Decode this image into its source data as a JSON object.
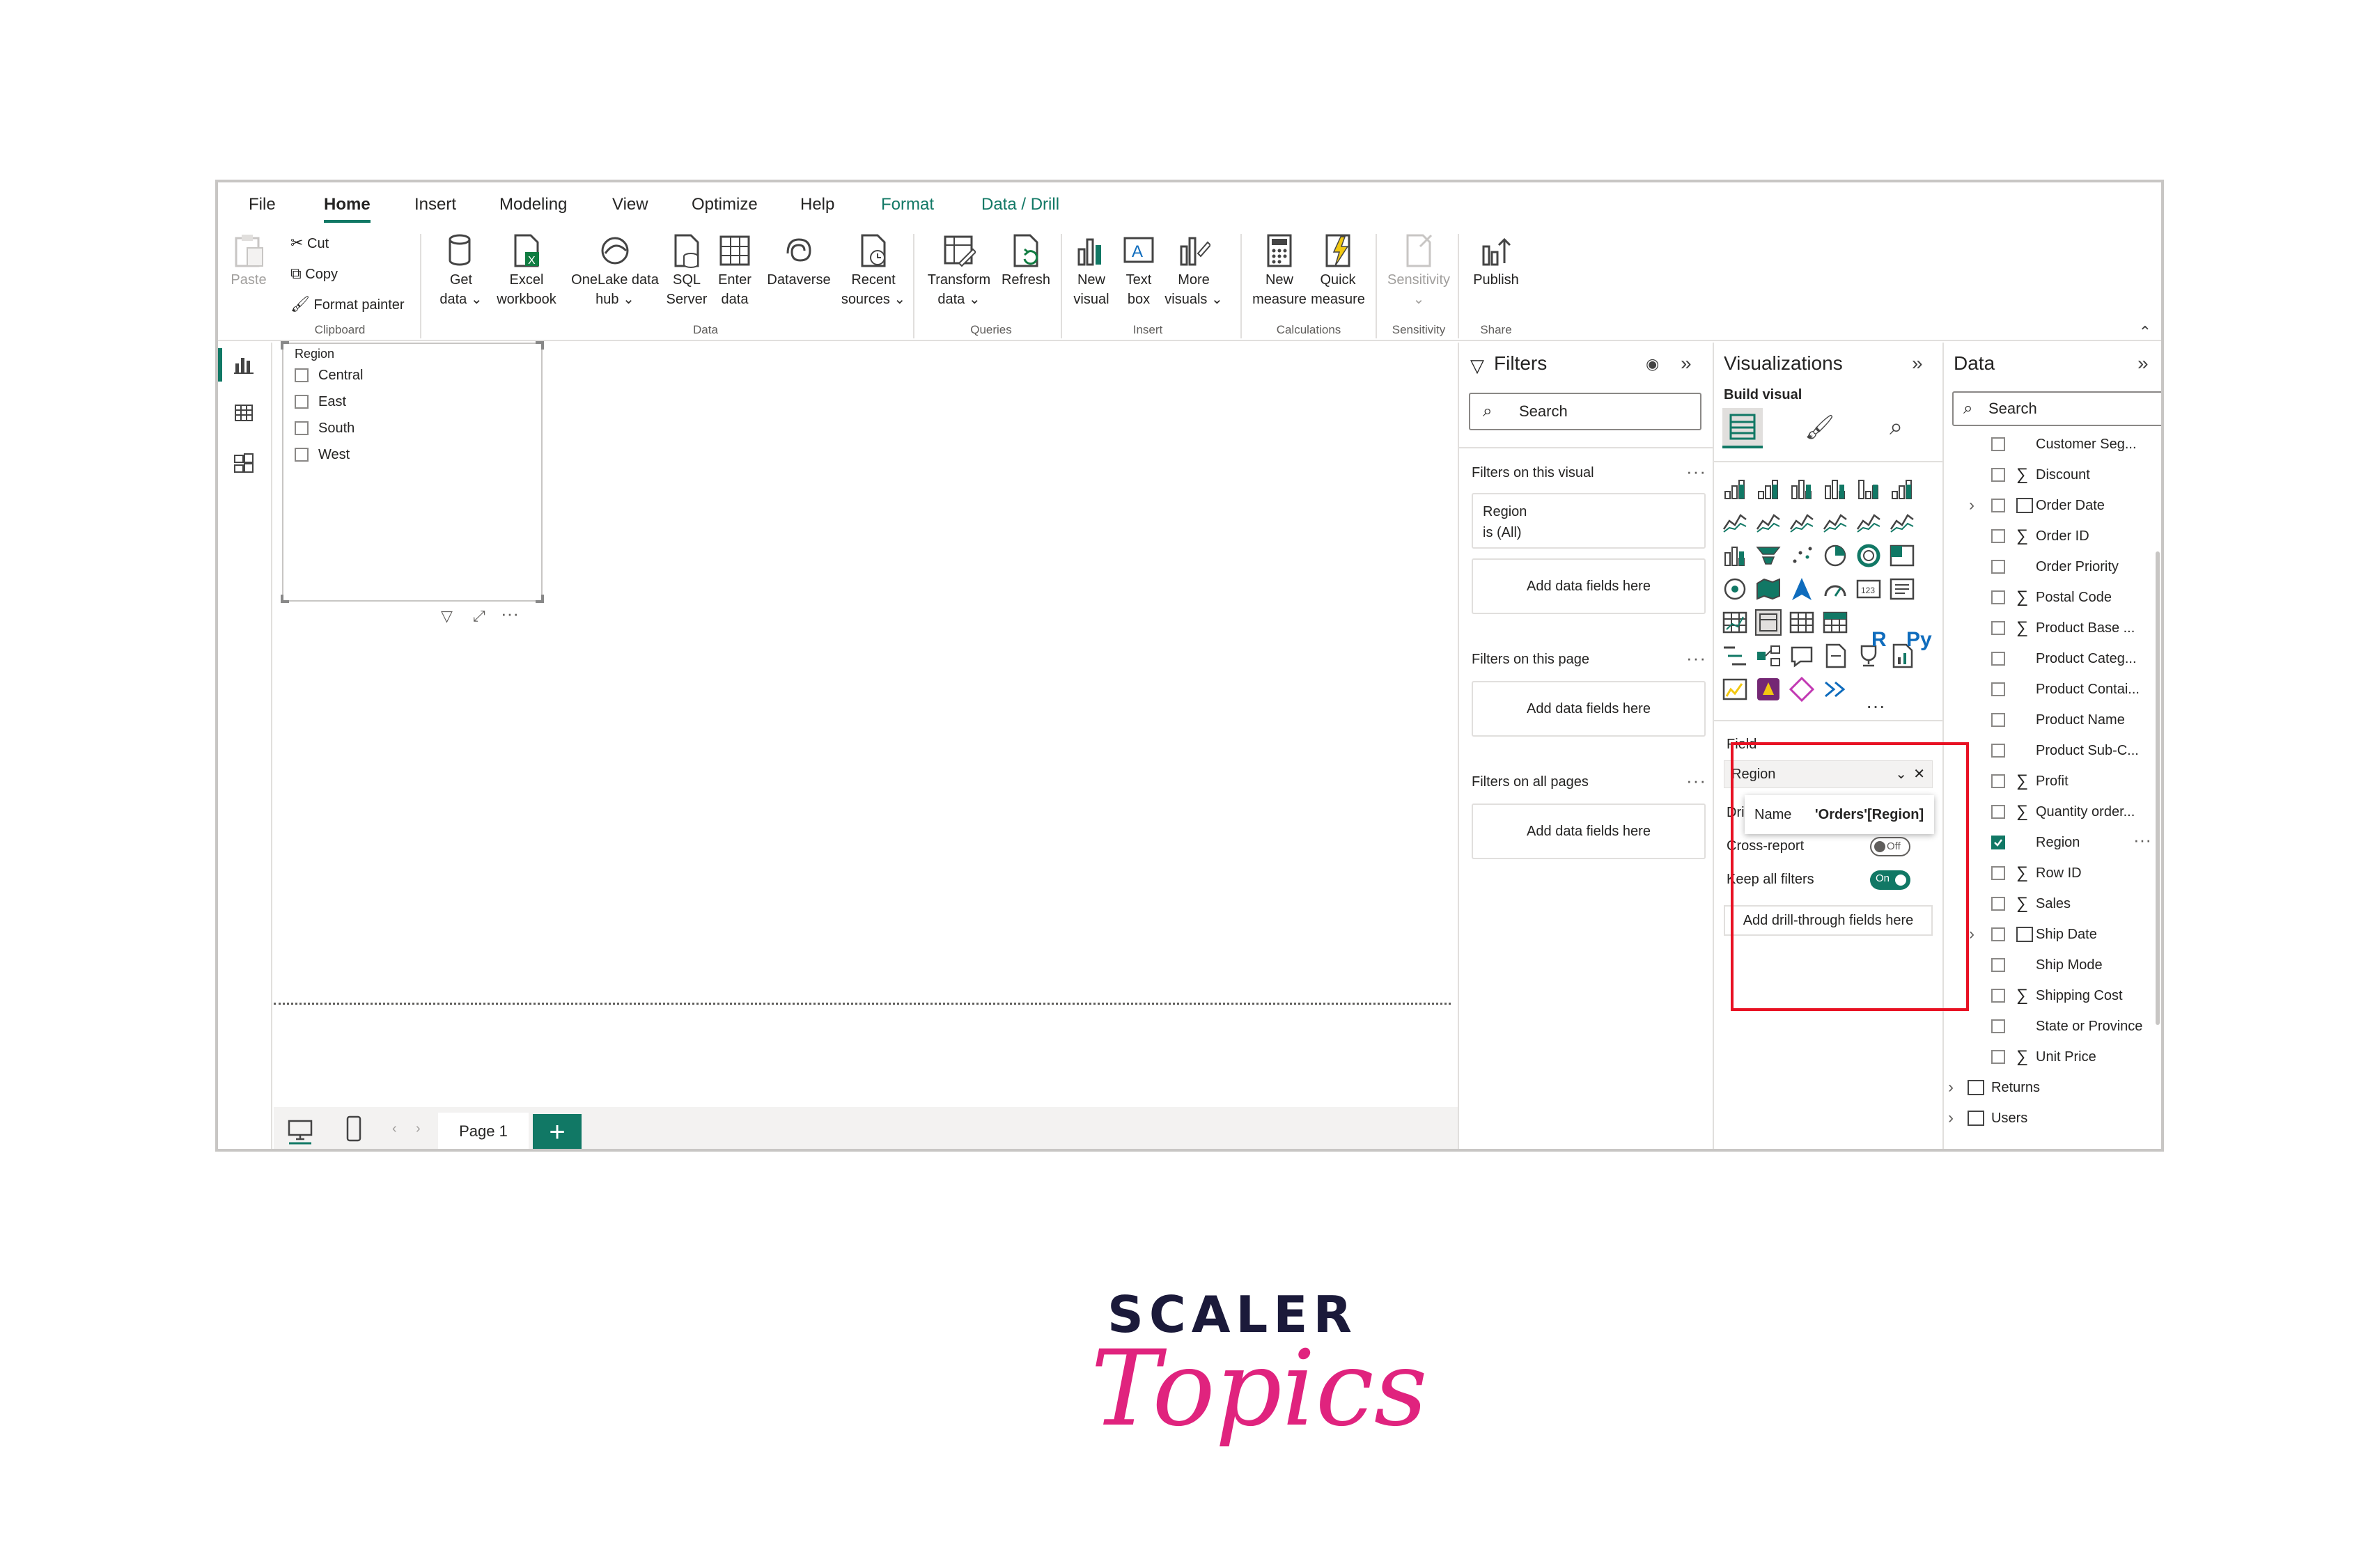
{
  "tabs": [
    "File",
    "Home",
    "Insert",
    "Modeling",
    "View",
    "Optimize",
    "Help",
    "Format",
    "Data / Drill"
  ],
  "ribbon": {
    "paste": "Paste",
    "cut": "Cut",
    "copy": "Copy",
    "format_painter": "Format painter",
    "group_clipboard": "Clipboard",
    "get_data": [
      "Get",
      "data"
    ],
    "excel_workbook": [
      "Excel",
      "workbook"
    ],
    "onelake": [
      "OneLake data",
      "hub"
    ],
    "sql_server": [
      "SQL",
      "Server"
    ],
    "enter_data": [
      "Enter",
      "data"
    ],
    "dataverse": "Dataverse",
    "recent_sources": [
      "Recent",
      "sources"
    ],
    "group_data": "Data",
    "transform_data": [
      "Transform",
      "data"
    ],
    "refresh": "Refresh",
    "group_queries": "Queries",
    "new_visual": [
      "New",
      "visual"
    ],
    "text_box": [
      "Text",
      "box"
    ],
    "more_visuals": [
      "More",
      "visuals"
    ],
    "group_insert": "Insert",
    "new_measure": [
      "New",
      "measure"
    ],
    "quick_measure": [
      "Quick",
      "measure"
    ],
    "group_calculations": "Calculations",
    "sensitivity": "Sensitivity",
    "group_sensitivity": "Sensitivity",
    "publish": "Publish",
    "group_share": "Share"
  },
  "slicer": {
    "title": "Region",
    "items": [
      "Central",
      "East",
      "South",
      "West"
    ]
  },
  "pages": {
    "current": "Page 1",
    "add": "+"
  },
  "filters": {
    "title": "Filters",
    "search_placeholder": "Search",
    "on_visual": "Filters on this visual",
    "region_card": {
      "field": "Region",
      "value": "is (All)"
    },
    "add_fields": "Add data fields here",
    "on_page": "Filters on this page",
    "on_all_pages": "Filters on all pages"
  },
  "visualizations": {
    "title": "Visualizations",
    "build_visual": "Build visual",
    "r_label": "R",
    "py_label": "Py",
    "more": "···",
    "drill": {
      "field_label": "Field",
      "field_value": "Region",
      "tooltip_name": "Name",
      "tooltip_value": "'Orders'[Region]",
      "drill_prefix": "Dri",
      "cross_report": "Cross-report",
      "cross_report_state": "Off",
      "keep_all_filters": "Keep all filters",
      "keep_state": "On",
      "add_drill": "Add drill-through fields here"
    }
  },
  "data_pane": {
    "title": "Data",
    "search_placeholder": "Search",
    "fields": [
      {
        "label": "Customer Seg...",
        "sigma": false,
        "table": false,
        "checked": false
      },
      {
        "label": "Discount",
        "sigma": true,
        "table": false,
        "checked": false
      },
      {
        "label": "Order Date",
        "sigma": false,
        "table": true,
        "checked": false,
        "expand": true
      },
      {
        "label": "Order ID",
        "sigma": true,
        "table": false,
        "checked": false
      },
      {
        "label": "Order Priority",
        "sigma": false,
        "table": false,
        "checked": false
      },
      {
        "label": "Postal Code",
        "sigma": true,
        "table": false,
        "checked": false
      },
      {
        "label": "Product Base ...",
        "sigma": true,
        "table": false,
        "checked": false
      },
      {
        "label": "Product Categ...",
        "sigma": false,
        "table": false,
        "checked": false
      },
      {
        "label": "Product Contai...",
        "sigma": false,
        "table": false,
        "checked": false
      },
      {
        "label": "Product Name",
        "sigma": false,
        "table": false,
        "checked": false
      },
      {
        "label": "Product Sub-C...",
        "sigma": false,
        "table": false,
        "checked": false
      },
      {
        "label": "Profit",
        "sigma": true,
        "table": false,
        "checked": false
      },
      {
        "label": "Quantity order...",
        "sigma": true,
        "table": false,
        "checked": false
      },
      {
        "label": "Region",
        "sigma": false,
        "table": false,
        "checked": true
      },
      {
        "label": "Row ID",
        "sigma": true,
        "table": false,
        "checked": false
      },
      {
        "label": "Sales",
        "sigma": true,
        "table": false,
        "checked": false
      },
      {
        "label": "Ship Date",
        "sigma": false,
        "table": true,
        "checked": false,
        "expand": true
      },
      {
        "label": "Ship Mode",
        "sigma": false,
        "table": false,
        "checked": false
      },
      {
        "label": "Shipping Cost",
        "sigma": true,
        "table": false,
        "checked": false
      },
      {
        "label": "State or Province",
        "sigma": false,
        "table": false,
        "checked": false
      },
      {
        "label": "Unit Price",
        "sigma": true,
        "table": false,
        "checked": false
      }
    ],
    "tables": [
      "Returns",
      "Users"
    ]
  },
  "logo": {
    "line1": "SCALER",
    "line2": "Topics"
  },
  "colors": {
    "accent": "#117865",
    "highlight": "#e81123",
    "logo_pink": "#e0237e",
    "logo_navy": "#1b1a3a"
  }
}
